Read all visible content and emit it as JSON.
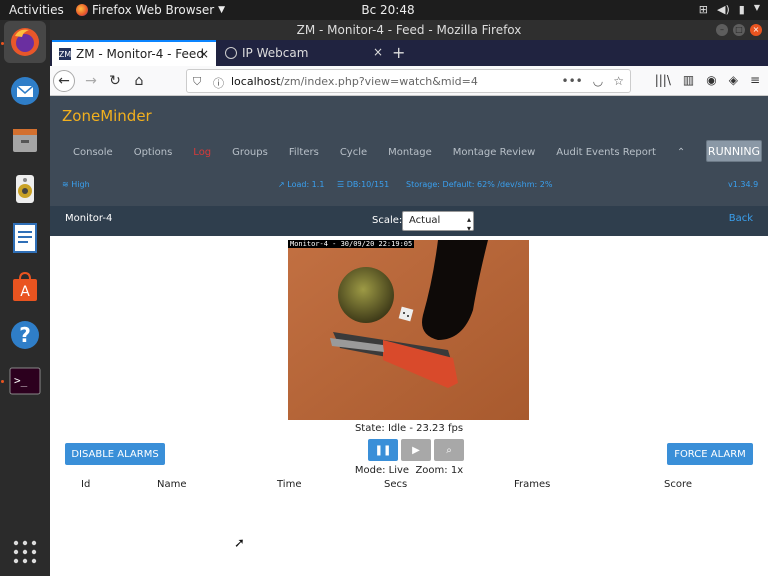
{
  "topbar": {
    "activities": "Activities",
    "app_name": "Firefox Web Browser",
    "clock": "Вс 20:48"
  },
  "window": {
    "title": "ZM - Monitor-4 - Feed - Mozilla Firefox"
  },
  "tabs": [
    {
      "label": "ZM - Monitor-4 - Feed",
      "favicon": "ZM"
    },
    {
      "label": "IP Webcam"
    }
  ],
  "url": {
    "host": "localhost",
    "path": "/zm/index.php?view=watch&mid=4"
  },
  "zm": {
    "logo": "ZoneMinder",
    "nav": [
      "Console",
      "Options",
      "Log",
      "Groups",
      "Filters",
      "Cycle",
      "Montage",
      "Montage Review",
      "Audit Events Report"
    ],
    "running": "RUNNING",
    "status": {
      "bandwidth": "High",
      "load": "Load: 1.1",
      "db": "DB:10/151",
      "storage": "Storage: Default: 62% /dev/shm: 2%",
      "version": "v1.34.9"
    },
    "monitor_name": "Monitor-4",
    "scale_label": "Scale:",
    "scale_value": "Actual",
    "back": "Back",
    "feed_overlay": "Monitor-4 - 30/09/20 22:19:05",
    "disable_alarms": "DISABLE ALARMS",
    "force_alarm": "FORCE ALARM",
    "state": "State: Idle - 23.23 fps",
    "mode": "Mode: Live",
    "zoom": "Zoom: 1x",
    "event_columns": [
      "Id",
      "Name",
      "Time",
      "Secs",
      "Frames",
      "Score"
    ]
  },
  "colors": {
    "accent": "#3a8fd8",
    "zm_header": "#3e4a57",
    "zm_logo": "#f2b01e",
    "log_red": "#d73a3a"
  }
}
